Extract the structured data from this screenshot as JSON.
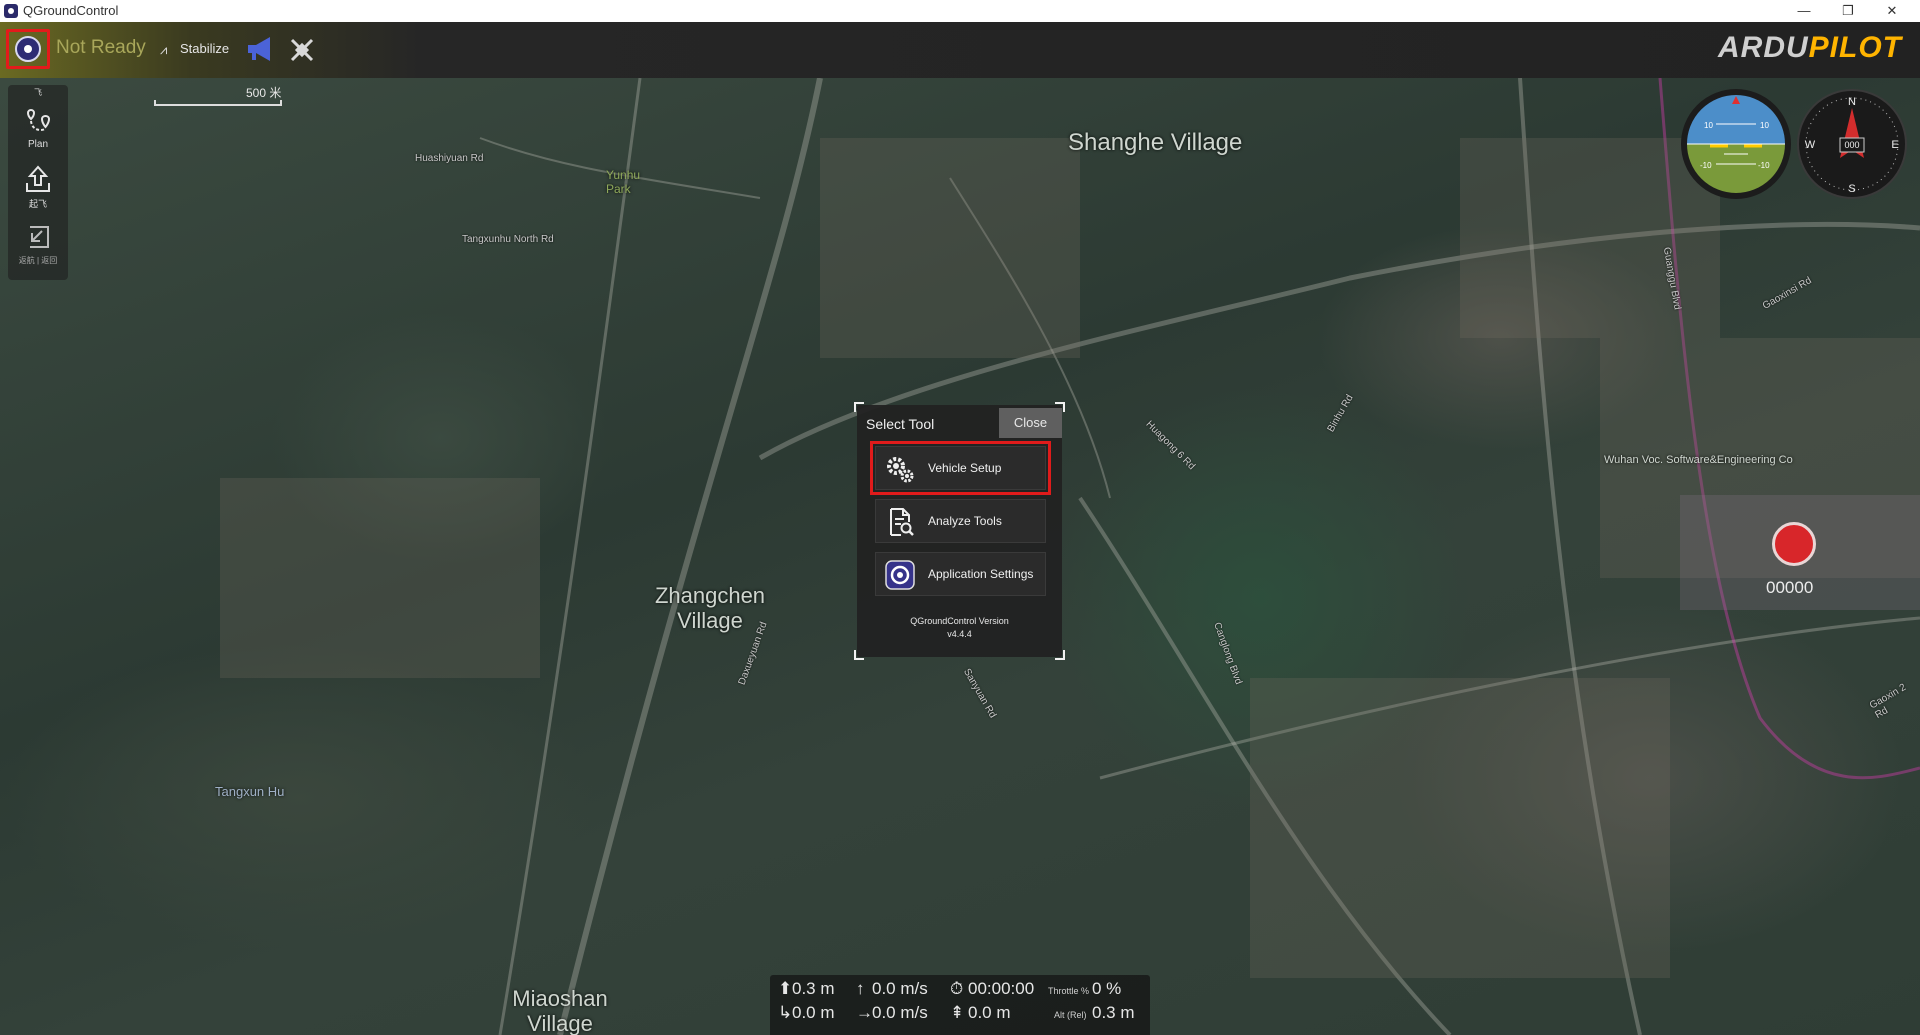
{
  "window": {
    "title": "QGroundControl",
    "controls": {
      "minimize": "—",
      "restore": "❐",
      "close": "✕"
    }
  },
  "toolbar": {
    "status": "Not Ready",
    "flight_mode_icon": "wings-icon",
    "flight_mode": "Stabilize",
    "brand_left": "ARDU",
    "brand_right": "PILOT",
    "colors": {
      "status": "#a9a75a",
      "brand_accent": "#ffb400",
      "highlight": "#e31b1b"
    }
  },
  "left_tools": [
    {
      "icon": "plan-route-icon",
      "label": "Plan"
    },
    {
      "icon": "takeoff-icon",
      "label": "起飞"
    },
    {
      "icon": "return-icon",
      "label": "返航 | 返回"
    }
  ],
  "map": {
    "scale": "500 米",
    "labels": [
      {
        "text": "Shanghe Village"
      },
      {
        "text": "Zhangchen Village"
      },
      {
        "text": "Miaoshan Village"
      },
      {
        "text": "Tangxun Hu"
      },
      {
        "text": "Wuhan Voc. Software&Engineering Co"
      },
      {
        "text": "Yunhu Park"
      }
    ],
    "roads": [
      "Huashiyuan Rd",
      "Tangxunhu North Rd",
      "Daxueyuan Rd",
      "Sanyuan Rd",
      "Canglong Blvd",
      "Gaoxinsi Rd",
      "Guanggu Blvd",
      "Binhu Rd",
      "Huagong 6 Rd",
      "Gaoxin 2 Rd"
    ]
  },
  "instruments": {
    "attitude": {
      "pitch_marks": [
        "10",
        "10",
        "-10",
        "-10"
      ]
    },
    "compass": {
      "n": "N",
      "e": "E",
      "s": "S",
      "w": "W",
      "heading": "000"
    }
  },
  "dialog": {
    "title": "Select Tool",
    "close_label": "Close",
    "buttons": [
      {
        "icon": "gears-icon",
        "label": "Vehicle Setup"
      },
      {
        "icon": "analyze-document-icon",
        "label": "Analyze Tools"
      },
      {
        "icon": "qgc-logo-icon",
        "label": "Application Settings"
      }
    ],
    "version_label": "QGroundControl Version",
    "version": "v4.4.4"
  },
  "telemetry": {
    "altitude": "0.3 m",
    "vertical_speed": "0.0 m/s",
    "flight_time": "00:00:00",
    "throttle_label": "Throttle %",
    "throttle": "0 %",
    "distance": "0.0 m",
    "horizontal_speed": "0.0 m/s",
    "dist_home": "0.0 m",
    "alt_rel_label": "Alt (Rel)",
    "alt_rel": "0.3 m"
  },
  "target": {
    "number": "00000"
  }
}
